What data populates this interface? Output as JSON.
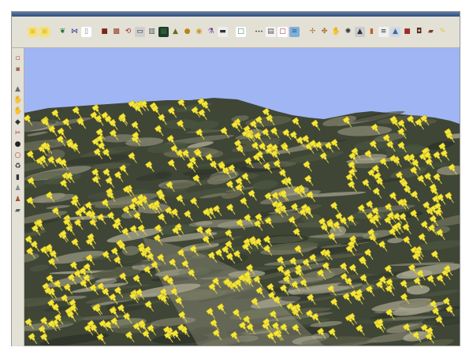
{
  "window": {
    "title_bar_color": "#3d5a8a"
  },
  "toolbar": {
    "tools": [
      {
        "icon": "folder-open-icon",
        "glyph": "▣",
        "color": "#e8c640",
        "bg": "#f6e27a"
      },
      {
        "icon": "save-icon",
        "glyph": "▣",
        "color": "#e8c640",
        "bg": "#f6e27a"
      },
      {
        "icon": "separator",
        "glyph": "",
        "color": "",
        "bg": ""
      },
      {
        "icon": "butterfly-icon",
        "glyph": "❦",
        "color": "#1a6e2a",
        "bg": "transparent"
      },
      {
        "icon": "bowtie-icon",
        "glyph": "⋈",
        "color": "#2a3f9e",
        "bg": "transparent"
      },
      {
        "icon": "page-icon",
        "glyph": "▯",
        "color": "#888888",
        "bg": "#ffffff"
      },
      {
        "icon": "separator",
        "glyph": "",
        "color": "",
        "bg": ""
      },
      {
        "icon": "film-icon",
        "glyph": "■",
        "color": "#7a2a1a",
        "bg": "transparent"
      },
      {
        "icon": "picture-icon",
        "glyph": "▩",
        "color": "#9a3a2a",
        "bg": "transparent"
      },
      {
        "icon": "lasso-icon",
        "glyph": "⟲",
        "color": "#a02a2a",
        "bg": "transparent"
      },
      {
        "icon": "monitor-icon",
        "glyph": "▭",
        "color": "#333333",
        "bg": "#cfcfcf"
      },
      {
        "icon": "trash-icon",
        "glyph": "▥",
        "color": "#555555",
        "bg": "transparent"
      },
      {
        "icon": "chip-icon",
        "glyph": "▦",
        "color": "#2f6e3a",
        "bg": "#1f3a2a"
      },
      {
        "icon": "terrain-icon",
        "glyph": "▲",
        "color": "#6a6a2a",
        "bg": "transparent"
      },
      {
        "icon": "globe-icon",
        "glyph": "●",
        "color": "#b8860b",
        "bg": "transparent"
      },
      {
        "icon": "disc-icon",
        "glyph": "◉",
        "color": "#c79a20",
        "bg": "transparent"
      },
      {
        "icon": "flask-icon",
        "glyph": "⚗",
        "color": "#6a3aa0",
        "bg": "transparent"
      },
      {
        "icon": "text-box-icon",
        "glyph": "▬",
        "color": "#333333",
        "bg": "#eeeeee"
      },
      {
        "icon": "separator",
        "glyph": "",
        "color": "",
        "bg": ""
      },
      {
        "icon": "blank-frame-icon",
        "glyph": "□",
        "color": "#2e8b57",
        "bg": "#ffffff"
      },
      {
        "icon": "separator",
        "glyph": "",
        "color": "",
        "bg": ""
      },
      {
        "icon": "dots-icon",
        "glyph": "•••",
        "color": "#333333",
        "bg": "transparent"
      },
      {
        "icon": "document-icon",
        "glyph": "▤",
        "color": "#555555",
        "bg": "#f3f3f3"
      },
      {
        "icon": "card-icon",
        "glyph": "▢",
        "color": "#a03030",
        "bg": "#ffffff"
      },
      {
        "icon": "landscape-icon",
        "glyph": "≋",
        "color": "#2f5fa0",
        "bg": "#7fb0d8"
      },
      {
        "icon": "separator",
        "glyph": "",
        "color": "",
        "bg": ""
      },
      {
        "icon": "figure-icon",
        "glyph": "✢",
        "color": "#c07030",
        "bg": "transparent"
      },
      {
        "icon": "mannequin-icon",
        "glyph": "✤",
        "color": "#b06a30",
        "bg": "transparent"
      },
      {
        "icon": "hand-icon",
        "glyph": "✋",
        "color": "#a05a20",
        "bg": "transparent"
      },
      {
        "icon": "gear-icon",
        "glyph": "✺",
        "color": "#333333",
        "bg": "transparent"
      },
      {
        "icon": "mountain-icon",
        "glyph": "▲",
        "color": "#333333",
        "bg": "#cccccc"
      },
      {
        "icon": "tube-icon",
        "glyph": "▮",
        "color": "#c06020",
        "bg": "transparent"
      },
      {
        "icon": "list-icon",
        "glyph": "≡",
        "color": "#333333",
        "bg": "#f0f0f0"
      },
      {
        "icon": "landscape-photo-icon",
        "glyph": "▲",
        "color": "#3a6a9a",
        "bg": "#d0d8e8"
      },
      {
        "icon": "box-icon",
        "glyph": "■",
        "color": "#a02a2a",
        "bg": "transparent"
      },
      {
        "icon": "camera-icon",
        "glyph": "◘",
        "color": "#5a2a1a",
        "bg": "transparent"
      },
      {
        "icon": "layers-icon",
        "glyph": "▰",
        "color": "#7a3a2a",
        "bg": "transparent"
      },
      {
        "icon": "pencil-icon",
        "glyph": "✎",
        "color": "#e8c640",
        "bg": "transparent"
      }
    ]
  },
  "sidebar": {
    "tools": [
      {
        "icon": "clipboard-icon",
        "glyph": "▫",
        "color": "#c04040"
      },
      {
        "icon": "box-icon",
        "glyph": "▪",
        "color": "#a06a50"
      },
      {
        "icon": "separator",
        "glyph": "",
        "color": ""
      },
      {
        "icon": "triangle-icon",
        "glyph": "▲",
        "color": "#6a6a6a"
      },
      {
        "icon": "hand-icon",
        "glyph": "✋",
        "color": "#333333"
      },
      {
        "icon": "finger-icon",
        "glyph": "✋",
        "color": "#333333"
      },
      {
        "icon": "drop-icon",
        "glyph": "◆",
        "color": "#333333"
      },
      {
        "icon": "scissors-icon",
        "glyph": "✂",
        "color": "#c03030"
      },
      {
        "icon": "ball-icon",
        "glyph": "●",
        "color": "#222222"
      },
      {
        "icon": "circle-icon",
        "glyph": "○",
        "color": "#c03030"
      },
      {
        "icon": "recycle-icon",
        "glyph": "♻",
        "color": "#333333"
      },
      {
        "icon": "stamp-icon",
        "glyph": "▮",
        "color": "#333333"
      },
      {
        "icon": "person-icon",
        "glyph": "♟",
        "color": "#888888"
      },
      {
        "icon": "figure-icon",
        "glyph": "♟",
        "color": "#a05030"
      },
      {
        "icon": "layers-icon",
        "glyph": "▰",
        "color": "#606060"
      }
    ]
  },
  "scene": {
    "sky_color": "#a0b5f3",
    "terrain_colors": [
      "#3f4636",
      "#5a5f48",
      "#2e342a",
      "#7a7a62",
      "#8f8e78",
      "#4b5540",
      "#a8a690"
    ],
    "pin_color": "#f5e63a",
    "pin_outline": "#b8a61a"
  }
}
